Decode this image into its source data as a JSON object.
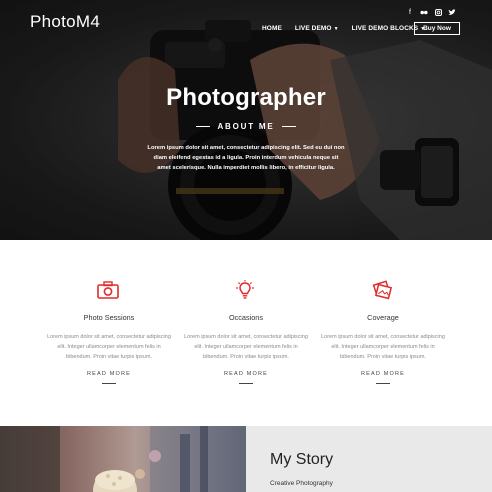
{
  "header": {
    "logo": "PhotoM4",
    "menu": [
      {
        "label": "HOME",
        "has_caret": false
      },
      {
        "label": "LIVE DEMO",
        "has_caret": true
      },
      {
        "label": "LIVE DEMO BLOCKS",
        "has_caret": true
      }
    ],
    "buy_label": "Buy Now",
    "social_icons": [
      "facebook-icon",
      "flickr-icon",
      "instagram-icon",
      "twitter-icon"
    ]
  },
  "hero": {
    "title": "Photographer",
    "subtitle": "ABOUT ME",
    "text": "Lorem ipsum dolor sit amet, consectetur adipiscing elit. Sed eu dui non diam eleifend egestas id a ligula. Proin interdum vehicula neque sit amet scelerisque. Nulla imperdiet mollis libero, in efficitur ligula."
  },
  "services": [
    {
      "icon": "camera-icon",
      "name": "Photo Sessions",
      "desc": "Lorem ipsum dolor sit amet, consectetur adipiscing elit. Integer ullamcorper elementum felis in bibendum. Proin vitae turpis ipsum.",
      "more": "READ MORE"
    },
    {
      "icon": "lightbulb-icon",
      "name": "Occasions",
      "desc": "Lorem ipsum dolor sit amet, consectetur adipiscing elit. Integer ullamcorper elementum felis in bibendum. Proin vitae turpis ipsum.",
      "more": "READ MORE"
    },
    {
      "icon": "photos-icon",
      "name": "Coverage",
      "desc": "Lorem ipsum dolor sit amet, consectetur adipiscing elit. Integer ullamcorper elementum felis in bibendum. Proin vitae turpis ipsum.",
      "more": "READ MORE"
    }
  ],
  "story": {
    "title": "My Story",
    "subtitle": "Creative Photography"
  },
  "colors": {
    "accent": "#e02b2b",
    "story_bg": "#e9e9e9"
  }
}
